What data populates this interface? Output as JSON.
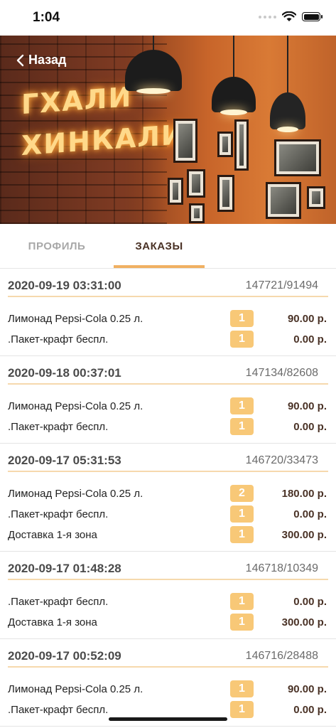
{
  "status_bar": {
    "time": "1:04"
  },
  "header": {
    "back_label": "Назад",
    "sign_text": "ГХАЛИ ХИНКАЛИ"
  },
  "tabs": [
    {
      "label": "ПРОФИЛЬ",
      "active": false
    },
    {
      "label": "ЗАКАЗЫ",
      "active": true
    }
  ],
  "colors": {
    "accent": "#f0b062",
    "qty_badge": "#f8c877",
    "price_text": "#4a3226"
  },
  "orders": [
    {
      "date": "2020-09-19 03:31:00",
      "number": "147721/91494",
      "items": [
        {
          "name": "Лимонад Pepsi-Cola 0.25 л.",
          "qty": "1",
          "price": "90.00 р."
        },
        {
          "name": ".Пакет-крафт беспл.",
          "qty": "1",
          "price": "0.00 р."
        }
      ]
    },
    {
      "date": "2020-09-18 00:37:01",
      "number": "147134/82608",
      "items": [
        {
          "name": "Лимонад Pepsi-Cola 0.25 л.",
          "qty": "1",
          "price": "90.00 р."
        },
        {
          "name": ".Пакет-крафт беспл.",
          "qty": "1",
          "price": "0.00 р."
        }
      ]
    },
    {
      "date": "2020-09-17 05:31:53",
      "number": "146720/33473",
      "items": [
        {
          "name": "Лимонад Pepsi-Cola 0.25 л.",
          "qty": "2",
          "price": "180.00 р."
        },
        {
          "name": ".Пакет-крафт беспл.",
          "qty": "1",
          "price": "0.00 р."
        },
        {
          "name": "Доставка 1-я зона",
          "qty": "1",
          "price": "300.00 р."
        }
      ]
    },
    {
      "date": "2020-09-17 01:48:28",
      "number": "146718/10349",
      "items": [
        {
          "name": ".Пакет-крафт беспл.",
          "qty": "1",
          "price": "0.00 р."
        },
        {
          "name": "Доставка 1-я зона",
          "qty": "1",
          "price": "300.00 р."
        }
      ]
    },
    {
      "date": "2020-09-17 00:52:09",
      "number": "146716/28488",
      "items": [
        {
          "name": "Лимонад Pepsi-Cola 0.25 л.",
          "qty": "1",
          "price": "90.00 р."
        },
        {
          "name": ".Пакет-крафт беспл.",
          "qty": "1",
          "price": "0.00 р."
        }
      ]
    }
  ]
}
